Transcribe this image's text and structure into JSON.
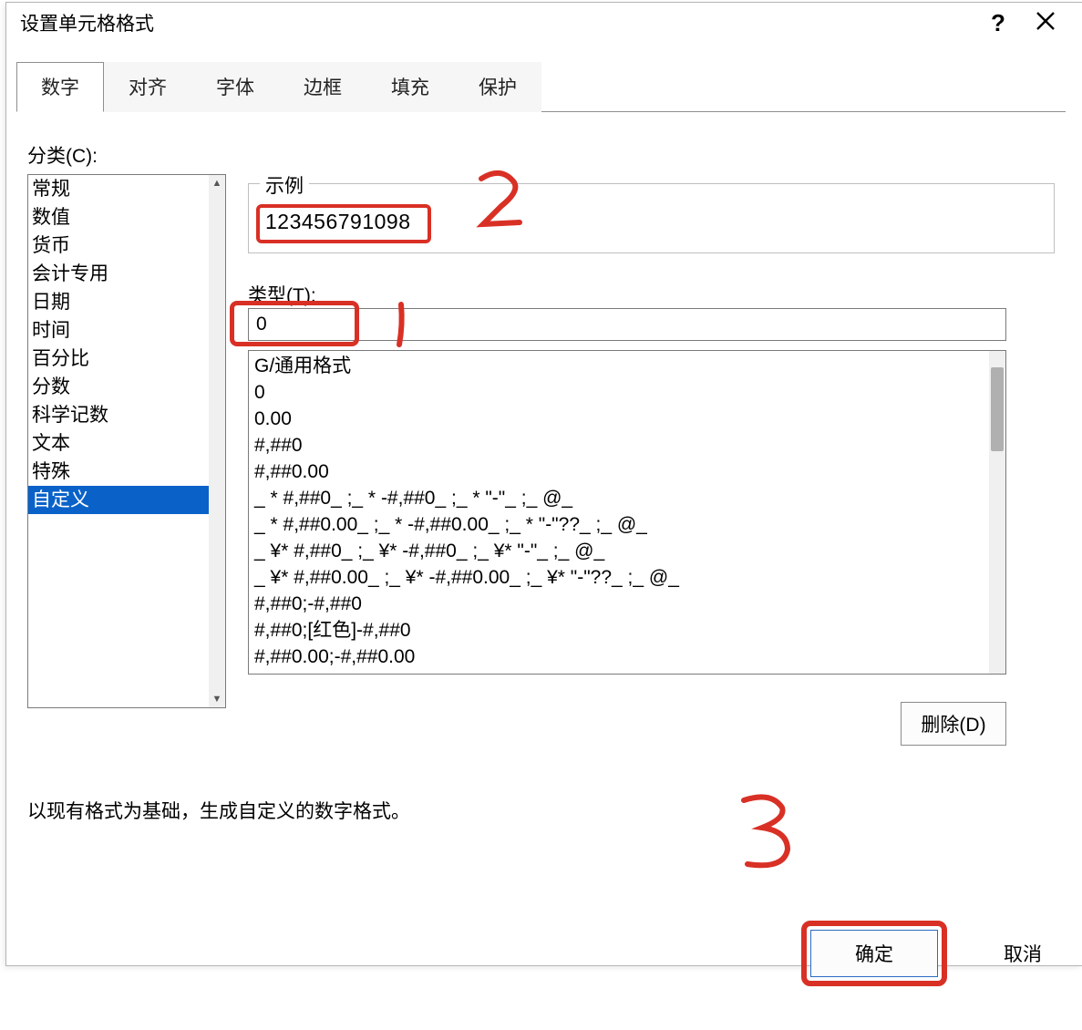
{
  "title": "设置单元格格式",
  "window": {
    "help": "?",
    "close": "×"
  },
  "tabs": [
    "数字",
    "对齐",
    "字体",
    "边框",
    "填充",
    "保护"
  ],
  "activeTabIndex": 0,
  "categoryLabel": "分类(C):",
  "categories": [
    "常规",
    "数值",
    "货币",
    "会计专用",
    "日期",
    "时间",
    "百分比",
    "分数",
    "科学记数",
    "文本",
    "特殊",
    "自定义"
  ],
  "selectedCategoryIndex": 11,
  "sample": {
    "legend": "示例",
    "value": "123456791098"
  },
  "type": {
    "label": "类型(T):",
    "value": "0"
  },
  "formatList": [
    "G/通用格式",
    "0",
    "0.00",
    "#,##0",
    "#,##0.00",
    "_ * #,##0_ ;_ * -#,##0_ ;_ * \"-\"_ ;_ @_",
    "_ * #,##0.00_ ;_ * -#,##0.00_ ;_ * \"-\"??_ ;_ @_",
    "_ ¥* #,##0_ ;_ ¥* -#,##0_ ;_ ¥* \"-\"_ ;_ @_",
    "_ ¥* #,##0.00_ ;_ ¥* -#,##0.00_ ;_ ¥* \"-\"??_ ;_ @_",
    "#,##0;-#,##0",
    "#,##0;[红色]-#,##0",
    "#,##0.00;-#,##0.00"
  ],
  "deleteLabel": "删除(D)",
  "hint": "以现有格式为基础，生成自定义的数字格式。",
  "buttons": {
    "ok": "确定",
    "cancel": "取消"
  },
  "annotations": {
    "one": "1",
    "two": "2",
    "three": "3"
  }
}
